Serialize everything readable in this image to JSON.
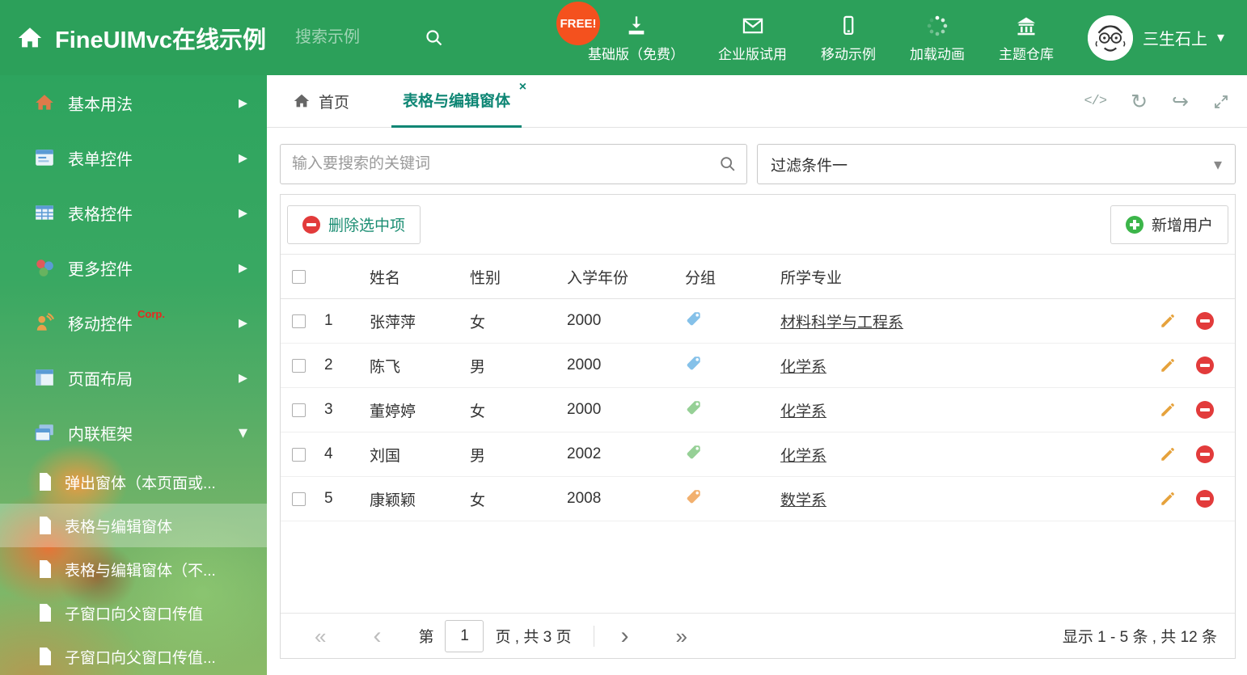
{
  "header": {
    "title": "FineUIMvc在线示例",
    "search": {
      "placeholder": "搜索示例"
    },
    "free_badge": "FREE!",
    "nav": [
      {
        "label": "基础版（免费）",
        "icon": "download-icon"
      },
      {
        "label": "企业版试用",
        "icon": "envelope-icon"
      },
      {
        "label": "移动示例",
        "icon": "mobile-icon"
      },
      {
        "label": "加载动画",
        "icon": "spinner-icon"
      },
      {
        "label": "主题仓库",
        "icon": "bank-icon"
      }
    ],
    "user": {
      "name": "三生石上"
    }
  },
  "sidebar": {
    "items": [
      {
        "label": "基本用法",
        "icon": "home-icon"
      },
      {
        "label": "表单控件",
        "icon": "form-icon"
      },
      {
        "label": "表格控件",
        "icon": "table-icon"
      },
      {
        "label": "更多控件",
        "icon": "widgets-icon"
      },
      {
        "label": "移动控件",
        "badge": "Corp.",
        "icon": "mobile-controls-icon"
      },
      {
        "label": "页面布局",
        "icon": "layout-icon"
      },
      {
        "label": "内联框架",
        "icon": "iframe-icon",
        "expanded": true,
        "children": [
          {
            "label": "弹出窗体（本页面或..."
          },
          {
            "label": "表格与编辑窗体",
            "selected": true
          },
          {
            "label": "表格与编辑窗体（不..."
          },
          {
            "label": "子窗口向父窗口传值"
          },
          {
            "label": "子窗口向父窗口传值..."
          }
        ]
      }
    ]
  },
  "tabs": {
    "home": "首页",
    "active": "表格与编辑窗体"
  },
  "filter_bar": {
    "search_placeholder": "输入要搜索的关键词",
    "filter_selected": "过滤条件一"
  },
  "grid": {
    "toolbar": {
      "delete_label": "删除选中项",
      "add_label": "新增用户"
    },
    "columns": {
      "name": "姓名",
      "gender": "性别",
      "year": "入学年份",
      "group": "分组",
      "major": "所学专业"
    },
    "rows": [
      {
        "num": "1",
        "name": "张萍萍",
        "gender": "女",
        "year": "2000",
        "tag_color": "#85c1e9",
        "major": "材料科学与工程系"
      },
      {
        "num": "2",
        "name": "陈飞",
        "gender": "男",
        "year": "2000",
        "tag_color": "#85c1e9",
        "major": "化学系"
      },
      {
        "num": "3",
        "name": "董婷婷",
        "gender": "女",
        "year": "2000",
        "tag_color": "#96d096",
        "major": "化学系"
      },
      {
        "num": "4",
        "name": "刘国",
        "gender": "男",
        "year": "2002",
        "tag_color": "#96d096",
        "major": "化学系"
      },
      {
        "num": "5",
        "name": "康颖颖",
        "gender": "女",
        "year": "2008",
        "tag_color": "#f2b06e",
        "major": "数学系"
      }
    ],
    "pager": {
      "prefix": "第",
      "page_value": "1",
      "suffix": "页 , 共 3 页",
      "summary": "显示 1 - 5 条 , 共 12 条"
    }
  },
  "colors": {
    "header_green": "#2ca05a",
    "accent_teal": "#0e8674",
    "danger_red": "#e23b3b",
    "pencil_orange": "#e6a23c",
    "add_green": "#3cb54a",
    "free_badge_orange": "#f4511e",
    "corp_badge_red": "#e8281e"
  }
}
